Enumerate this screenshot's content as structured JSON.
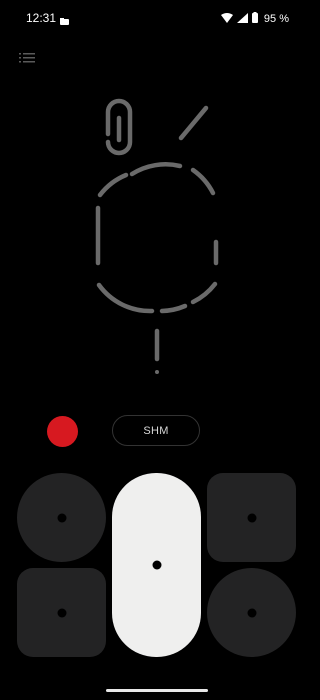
{
  "status_bar": {
    "time": "12:31",
    "battery": "95 %",
    "icons": [
      "notification-icon",
      "wifi-icon",
      "signal-icon",
      "battery-icon"
    ]
  },
  "menu": {
    "icon": "list-menu-icon"
  },
  "illustration": {
    "name": "nothing-phone-glyph-illustration"
  },
  "controls": {
    "record_color": "#d71920",
    "mode_label": "SHM"
  },
  "pads": [
    {
      "shape": "circle",
      "color": "#232324"
    },
    {
      "shape": "capsule",
      "color": "#efefee"
    },
    {
      "shape": "square",
      "color": "#232324"
    },
    {
      "shape": "square",
      "color": "#232324"
    },
    {
      "shape": "circle",
      "color": "#232324"
    }
  ]
}
